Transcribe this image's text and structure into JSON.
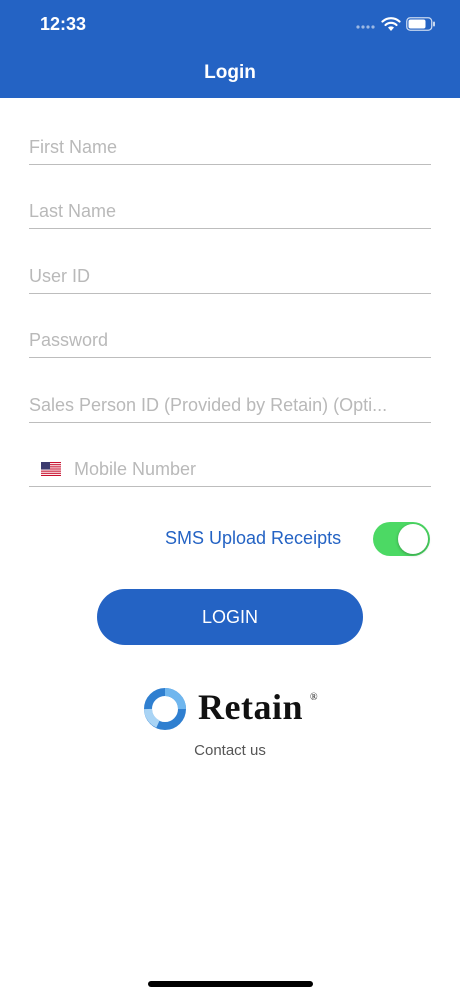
{
  "status_bar": {
    "time": "12:33"
  },
  "nav": {
    "title": "Login"
  },
  "form": {
    "first_name": {
      "placeholder": "First Name",
      "value": ""
    },
    "last_name": {
      "placeholder": "Last Name",
      "value": ""
    },
    "user_id": {
      "placeholder": "User ID",
      "value": ""
    },
    "password": {
      "placeholder": "Password",
      "value": ""
    },
    "sales_person_id": {
      "placeholder": "Sales Person ID (Provided by Retain) (Opti...",
      "value": ""
    },
    "mobile_number": {
      "placeholder": "Mobile Number",
      "value": "",
      "flag_icon": "us-flag-icon"
    }
  },
  "sms_upload": {
    "label": "SMS Upload Receipts",
    "enabled": true
  },
  "login_button": {
    "label": "LOGIN"
  },
  "brand": {
    "name": "Retain",
    "registered_mark": "®"
  },
  "contact": {
    "label": "Contact us"
  },
  "colors": {
    "primary": "#2463c4",
    "toggle_on": "#4cd964",
    "placeholder": "#b9b9b9",
    "divider": "#bdbdbd"
  }
}
